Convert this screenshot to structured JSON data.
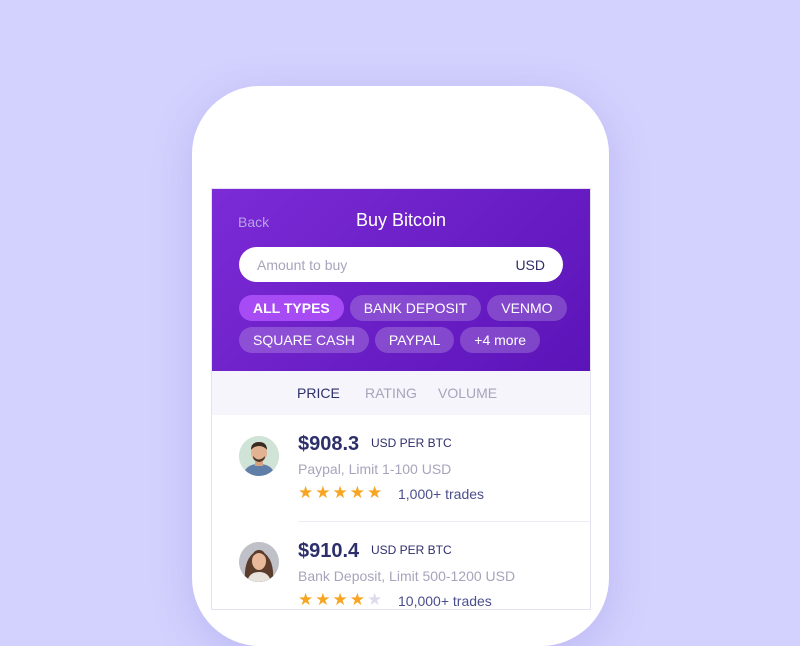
{
  "header": {
    "back_label": "Back",
    "title": "Buy Bitcoin",
    "amount_placeholder": "Amount to buy",
    "currency": "USD"
  },
  "filters": {
    "row1": [
      "ALL TYPES",
      "BANK DEPOSIT",
      "VENMO"
    ],
    "row2": [
      "SQUARE CASH",
      "PAYPAL",
      "+4 more"
    ],
    "active": "ALL TYPES"
  },
  "sort": {
    "price": "PRICE",
    "rating": "RATING",
    "volume": "VOLUME",
    "active": "PRICE"
  },
  "offers": [
    {
      "price": "$908.3",
      "unit": "USD PER BTC",
      "method": "Paypal, Limit 1-100 USD",
      "rating": 5,
      "trades": "1,000+ trades"
    },
    {
      "price": "$910.4",
      "unit": "USD PER BTC",
      "method": "Bank Deposit, Limit 500-1200 USD",
      "rating": 4,
      "trades": "10,000+ trades"
    }
  ],
  "colors": {
    "background": "#d3d1fd",
    "header_start": "#7c2bd6",
    "header_end": "#5b14b8",
    "active_chip": "#a74cf5",
    "star": "#f6a623",
    "text_dark": "#2d2f6b"
  },
  "icons": {
    "star": "star-icon"
  }
}
